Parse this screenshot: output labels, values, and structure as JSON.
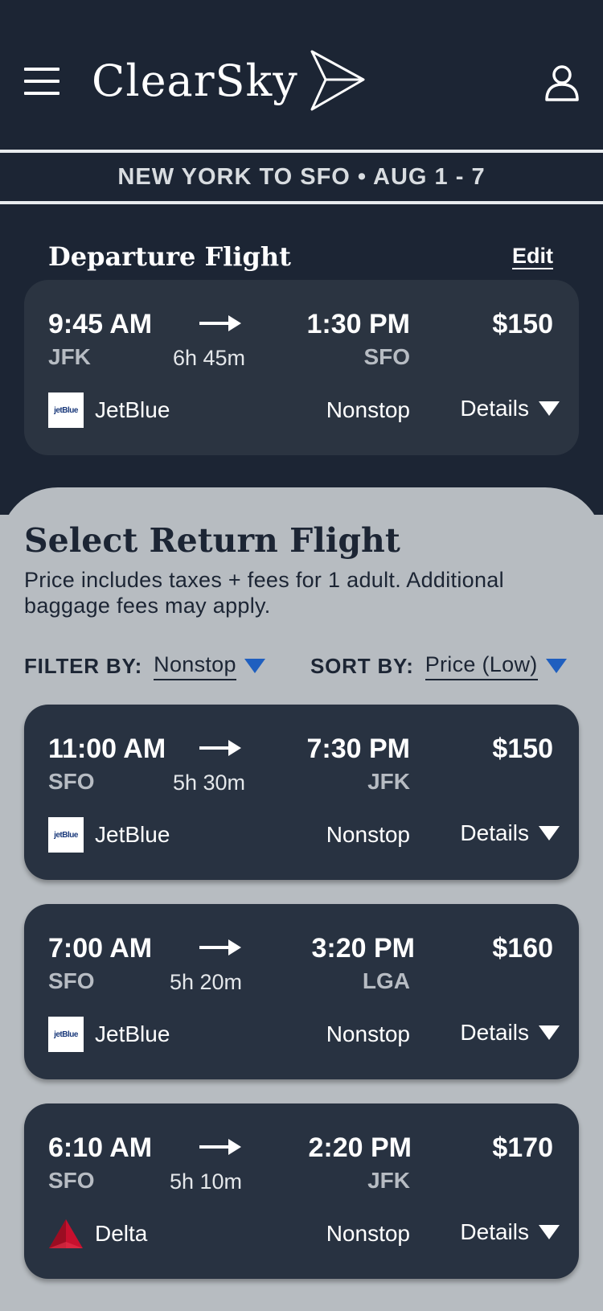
{
  "app": {
    "name": "ClearSky"
  },
  "route": {
    "text": "NEW YORK TO SFO • AUG 1 - 7"
  },
  "departure": {
    "title": "Departure Flight",
    "edit_label": "Edit",
    "flight": {
      "dep_time": "9:45 AM",
      "arr_time": "1:30 PM",
      "price": "$150",
      "dep_code": "JFK",
      "duration": "6h 45m",
      "arr_code": "SFO",
      "airline": "JetBlue",
      "stops": "Nonstop",
      "details_label": "Details"
    }
  },
  "return": {
    "title": "Select Return Flight",
    "note": "Price includes taxes + fees for 1 adult. Additional baggage fees may apply.",
    "filter_label": "FILTER BY:",
    "filter_value": "Nonstop",
    "sort_label": "SORT BY:",
    "sort_value": "Price (Low)",
    "flights": [
      {
        "dep_time": "11:00 AM",
        "arr_time": "7:30 PM",
        "price": "$150",
        "dep_code": "SFO",
        "duration": "5h 30m",
        "arr_code": "JFK",
        "airline": "JetBlue",
        "stops": "Nonstop",
        "details_label": "Details"
      },
      {
        "dep_time": "7:00 AM",
        "arr_time": "3:20 PM",
        "price": "$160",
        "dep_code": "SFO",
        "duration": "5h 20m",
        "arr_code": "LGA",
        "airline": "JetBlue",
        "stops": "Nonstop",
        "details_label": "Details"
      },
      {
        "dep_time": "6:10 AM",
        "arr_time": "2:20 PM",
        "price": "$170",
        "dep_code": "SFO",
        "duration": "5h 10m",
        "arr_code": "JFK",
        "airline": "Delta",
        "stops": "Nonstop",
        "details_label": "Details"
      }
    ]
  },
  "logos": {
    "jetblue_text": "jetBlue"
  },
  "colors": {
    "header_bg": "#1c2534",
    "card_bg": "#283241",
    "sheet_bg": "#b7bcc1",
    "accent_blue": "#1f5fbf",
    "delta_red": "#c8102e"
  },
  "icons": {
    "menu": "hamburger-menu-icon",
    "logo": "paper-plane-icon",
    "profile": "user-profile-icon",
    "arrow": "right-arrow-icon",
    "details": "caret-down-icon"
  }
}
